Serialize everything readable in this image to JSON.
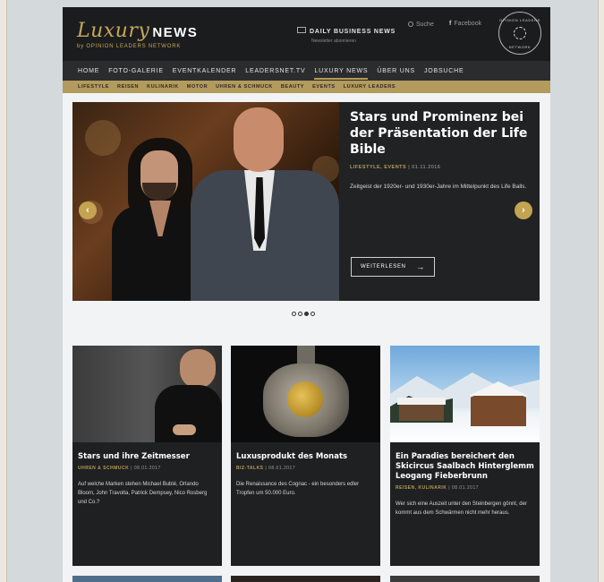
{
  "header": {
    "logo_script": "Luxury",
    "logo_word": "NEWS",
    "logo_sub": "by OPINION LEADERS NETWORK",
    "newsletter_title": "DAILY BUSINESS NEWS",
    "newsletter_sub": "Newsletter abonnieren",
    "search_label": "Suche",
    "facebook_label": "Facebook",
    "seal_top": "OPINION LEADERS",
    "seal_bottom": "NETWORK"
  },
  "main_nav": [
    {
      "label": "HOME",
      "active": false
    },
    {
      "label": "FOTO-GALERIE",
      "active": false
    },
    {
      "label": "EVENTKALENDER",
      "active": false
    },
    {
      "label": "LEADERSNET.TV",
      "active": false
    },
    {
      "label": "LUXURY NEWS",
      "active": true
    },
    {
      "label": "ÜBER UNS",
      "active": false
    },
    {
      "label": "JOBSUCHE",
      "active": false
    }
  ],
  "sub_nav": [
    "LIFESTYLE",
    "REISEN",
    "KULINARIK",
    "MOTOR",
    "UHREN & SCHMUCK",
    "BEAUTY",
    "EVENTS",
    "LUXURY LEADERS"
  ],
  "hero": {
    "title": "Stars und Prominenz bei der Präsentation der Life Bible",
    "category": "LIFESTYLE, EVENTS",
    "date": "01.11.2016",
    "description": "Zeitgeist der 1920er- und 1930er-Jahre im Mittelpunkt des Life Balls.",
    "button_label": "WEITERLESEN",
    "arrow_left": "‹",
    "arrow_right": "›"
  },
  "carousel": {
    "total": 4,
    "active_index": 2
  },
  "cards": [
    {
      "title": "Stars und ihre Zeitmesser",
      "category": "UHREN & SCHMUCK",
      "date": "08.01.2017",
      "description": "Auf welche Marken stehen Michael Bublé, Orlando Bloom, John Travolta, Patrick Dempsey, Nico Rosberg und Co.?"
    },
    {
      "title": "Luxusprodukt des Monats",
      "category": "BIZ-TALKS",
      "date": "08.01.2017",
      "description": "Die Renaissance des Cognac - ein besonders edler Tropfen um 50.000 Euro."
    },
    {
      "title": "Ein Paradies bereichert den Skicircus Saalbach Hinterglemm Leogang Fieberbrunn",
      "category": "REISEN, KULINARIK",
      "date": "08.01.2017",
      "description": "Wer sich eine Auszeit unter den Steinbergen gönnt, der kommt aus dem Schwärmen nicht mehr heraus."
    }
  ],
  "colors": {
    "gold": "#b89b56",
    "dark": "#1e2022",
    "nav": "#2a2c2e",
    "subnav": "#b39a5d"
  }
}
